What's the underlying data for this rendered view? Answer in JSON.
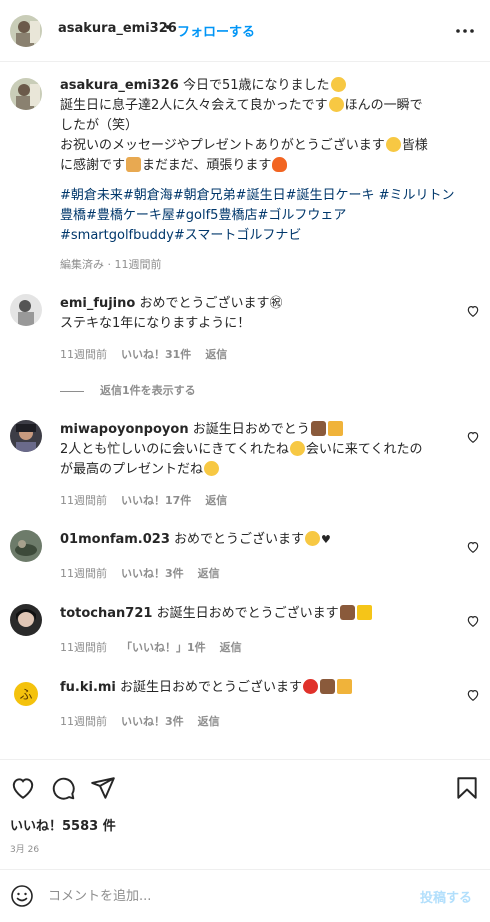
{
  "header": {
    "username": "asakura_emi326",
    "separator": "•",
    "follow_label": "フォローする",
    "more_icon": "more-horizontal-icon"
  },
  "caption": {
    "username": "asakura_emi326",
    "line1": "今日で51歳になりました",
    "line2": "誕生日に息子達2人に久々会えて良かったです",
    "line2b": "ほんの一瞬で",
    "line3": "したが（笑）",
    "line4": "お祝いのメッセージやプレゼントありがとうございます",
    "line4b": "皆様",
    "line5": "に感謝です",
    "line5b": "まだまだ、頑張ります",
    "hashtags_line1": "#朝倉未来#朝倉海#朝倉兄弟#誕生日#誕生日ケーキ #ミルリトン",
    "hashtags_line2": "豊橋#豊橋ケーキ屋#golf5豊橋店#ゴルフウェア",
    "hashtags_line3": "#smartgolfbuddy#スマートゴルフナビ",
    "meta": "編集済み · 11週間前"
  },
  "comments": [
    {
      "username": "emi_fujino",
      "text": "おめでとうございます㊗",
      "text2": "ステキな1年になりますように！",
      "time": "11週間前",
      "likes": "いいね！31件",
      "reply": "返信",
      "view_replies": "返信1件を表示する"
    },
    {
      "username": "miwapoyonpoyon",
      "text": "お誕生日おめでとう",
      "text2": "2人とも忙しいのに会いにきてくれたね",
      "text2b": "会いに来てくれたの",
      "text3": "が最高のプレゼントだね",
      "time": "11週間前",
      "likes": "いいね！17件",
      "reply": "返信"
    },
    {
      "username": "01monfam.023",
      "text": "おめでとうございます",
      "time": "11週間前",
      "likes": "いいね！3件",
      "reply": "返信"
    },
    {
      "username": "totochan721",
      "text": "お誕生日おめでとうございます",
      "time": "11週間前",
      "likes": "「いいね！」1件",
      "reply": "返信"
    },
    {
      "username": "fu.ki.mi",
      "text": "お誕生日おめでとうございます",
      "time": "11週間前",
      "likes": "いいね！3件",
      "reply": "返信"
    }
  ],
  "actions": {
    "like_icon": "heart-icon",
    "comment_icon": "comment-icon",
    "share_icon": "share-icon",
    "save_icon": "bookmark-icon",
    "likes_text": "いいね！5583 件",
    "date": "3月 26"
  },
  "comment_bar": {
    "placeholder": "コメントを追加...",
    "post_label": "投稿する"
  },
  "colors": {
    "accent": "#0095f6",
    "hashtag": "#00376b",
    "muted": "#8e8e8e",
    "post_disabled": "#b2dffc"
  }
}
